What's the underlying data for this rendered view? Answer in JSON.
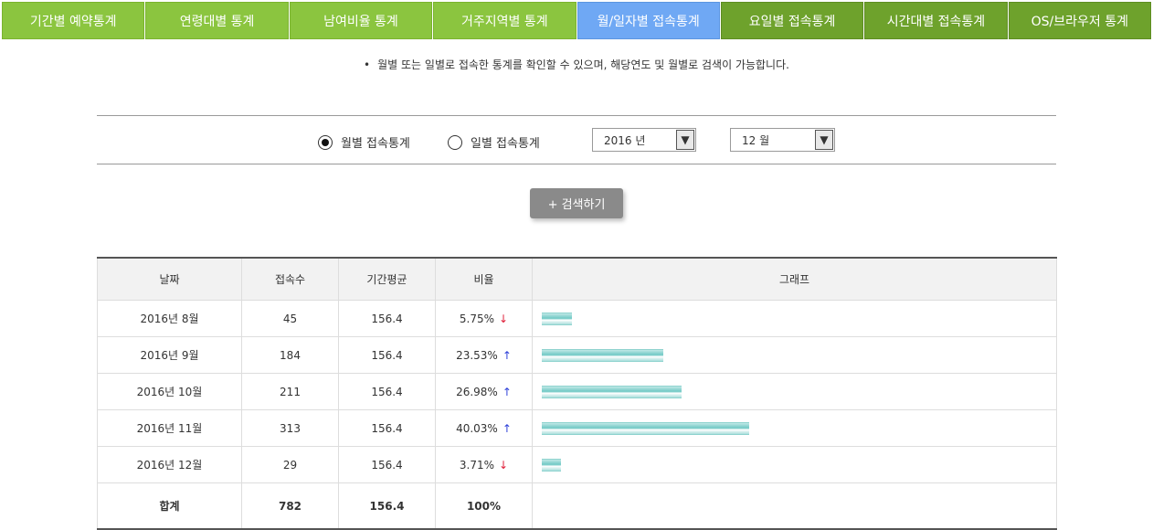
{
  "tabs": [
    {
      "label": "기간별 예약통계"
    },
    {
      "label": "연령대별 통계"
    },
    {
      "label": "남여비율 통계"
    },
    {
      "label": "거주지역별 통계"
    },
    {
      "label": "월/일자별 접속통계"
    },
    {
      "label": "요일별 접속통계"
    },
    {
      "label": "시간대별 접속통계"
    },
    {
      "label": "OS/브라우저 통계"
    }
  ],
  "notice": "월별 또는 일별로 접속한 통계를 확인할 수 있으며, 해당연도 및 월별로 검색이 가능합니다.",
  "filter": {
    "radio_monthly": "월별 접속통계",
    "radio_daily": "일별 접속통계",
    "year_value": "2016 년",
    "month_value": "12 월"
  },
  "search_button": "+ 검색하기",
  "table": {
    "headers": {
      "date": "날짜",
      "count": "접속수",
      "avg": "기간평균",
      "ratio": "비율",
      "graph": "그래프"
    },
    "rows": [
      {
        "date": "2016년 8월",
        "count": "45",
        "avg": "156.4",
        "ratio": "5.75%",
        "trend": "↓"
      },
      {
        "date": "2016년 9월",
        "count": "184",
        "avg": "156.4",
        "ratio": "23.53%",
        "trend": "↑"
      },
      {
        "date": "2016년 10월",
        "count": "211",
        "avg": "156.4",
        "ratio": "26.98%",
        "trend": "↑"
      },
      {
        "date": "2016년 11월",
        "count": "313",
        "avg": "156.4",
        "ratio": "40.03%",
        "trend": "↑"
      },
      {
        "date": "2016년 12월",
        "count": "29",
        "avg": "156.4",
        "ratio": "3.71%",
        "trend": "↓"
      }
    ],
    "total": {
      "label": "합계",
      "count": "782",
      "avg": "156.4",
      "ratio": "100%"
    }
  },
  "colors": {
    "tab": "#8bc53f",
    "tab_dark": "#6ea22c",
    "tab_active": "#6fa8f4",
    "trend_up": "#2c3fd8",
    "trend_down": "#e0203a"
  }
}
